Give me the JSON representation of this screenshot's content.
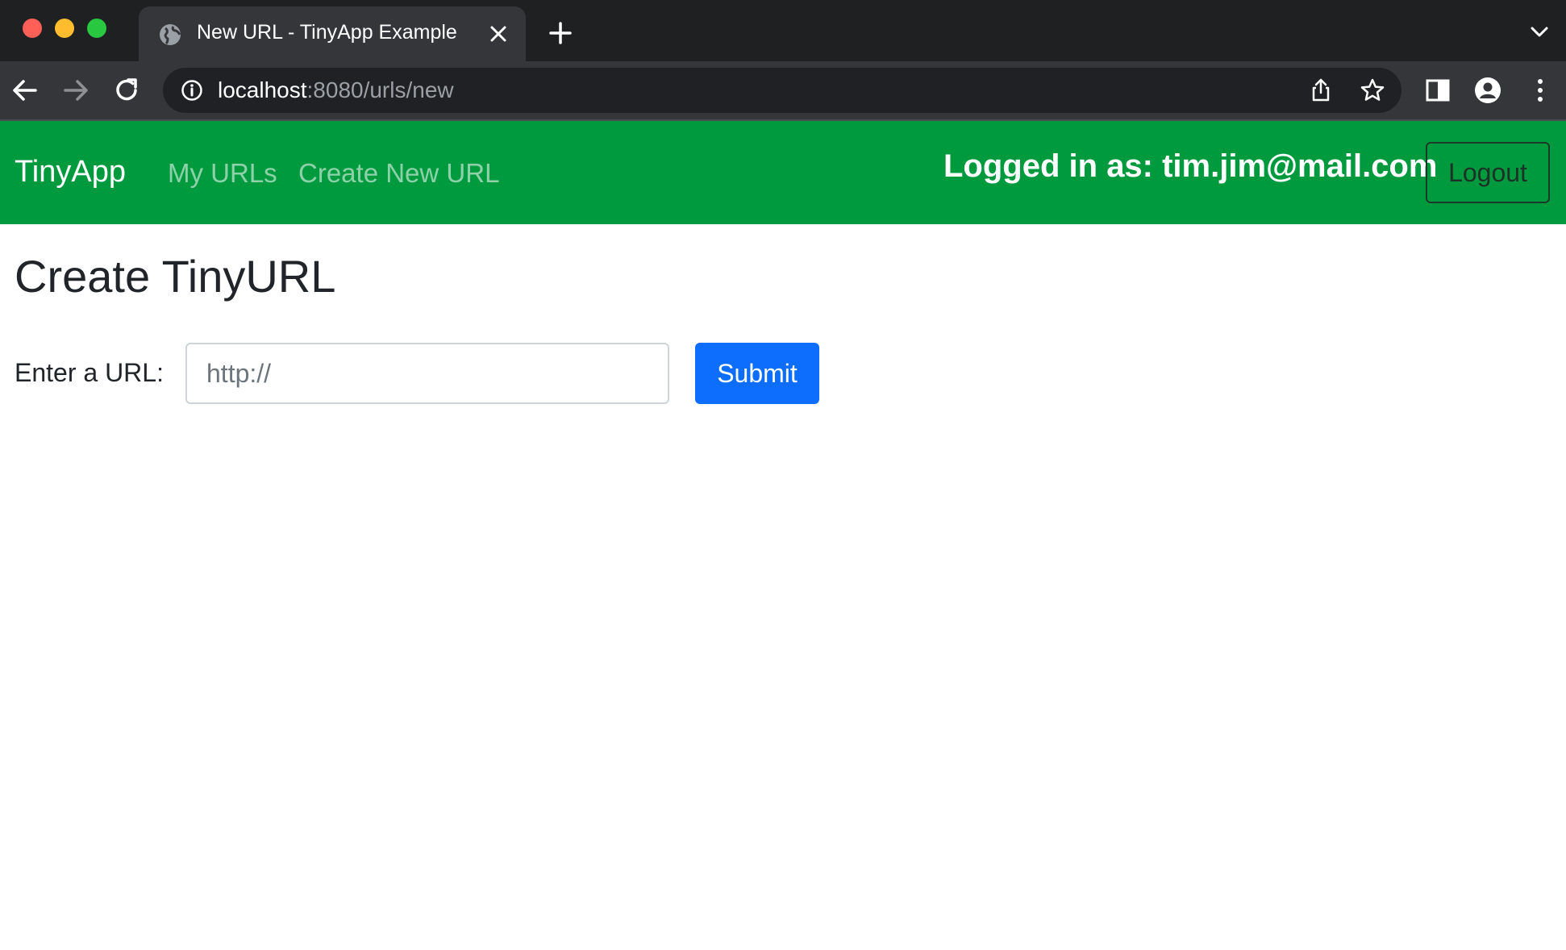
{
  "browser": {
    "tab": {
      "title": "New URL - TinyApp Example",
      "favicon": "globe-icon"
    },
    "address_bar": {
      "host": "localhost",
      "path": ":8080/urls/new"
    },
    "icons": [
      "back-arrow-icon",
      "forward-arrow-icon",
      "reload-icon",
      "info-icon",
      "share-icon",
      "star-icon",
      "side-panel-icon",
      "profile-icon",
      "more-vert-icon",
      "close-icon",
      "plus-icon",
      "chevron-down-icon"
    ]
  },
  "navbar": {
    "brand": "TinyApp",
    "links": [
      {
        "label": "My URLs"
      },
      {
        "label": "Create New URL"
      }
    ],
    "logged_in_text": "Logged in as: tim.jim@mail.com",
    "logout_label": "Logout",
    "background_color": "#009a3e"
  },
  "main": {
    "title": "Create TinyURL",
    "form": {
      "label": "Enter a URL:",
      "input_placeholder": "http://",
      "input_value": "",
      "submit_label": "Submit",
      "submit_color": "#0d6efd"
    }
  }
}
